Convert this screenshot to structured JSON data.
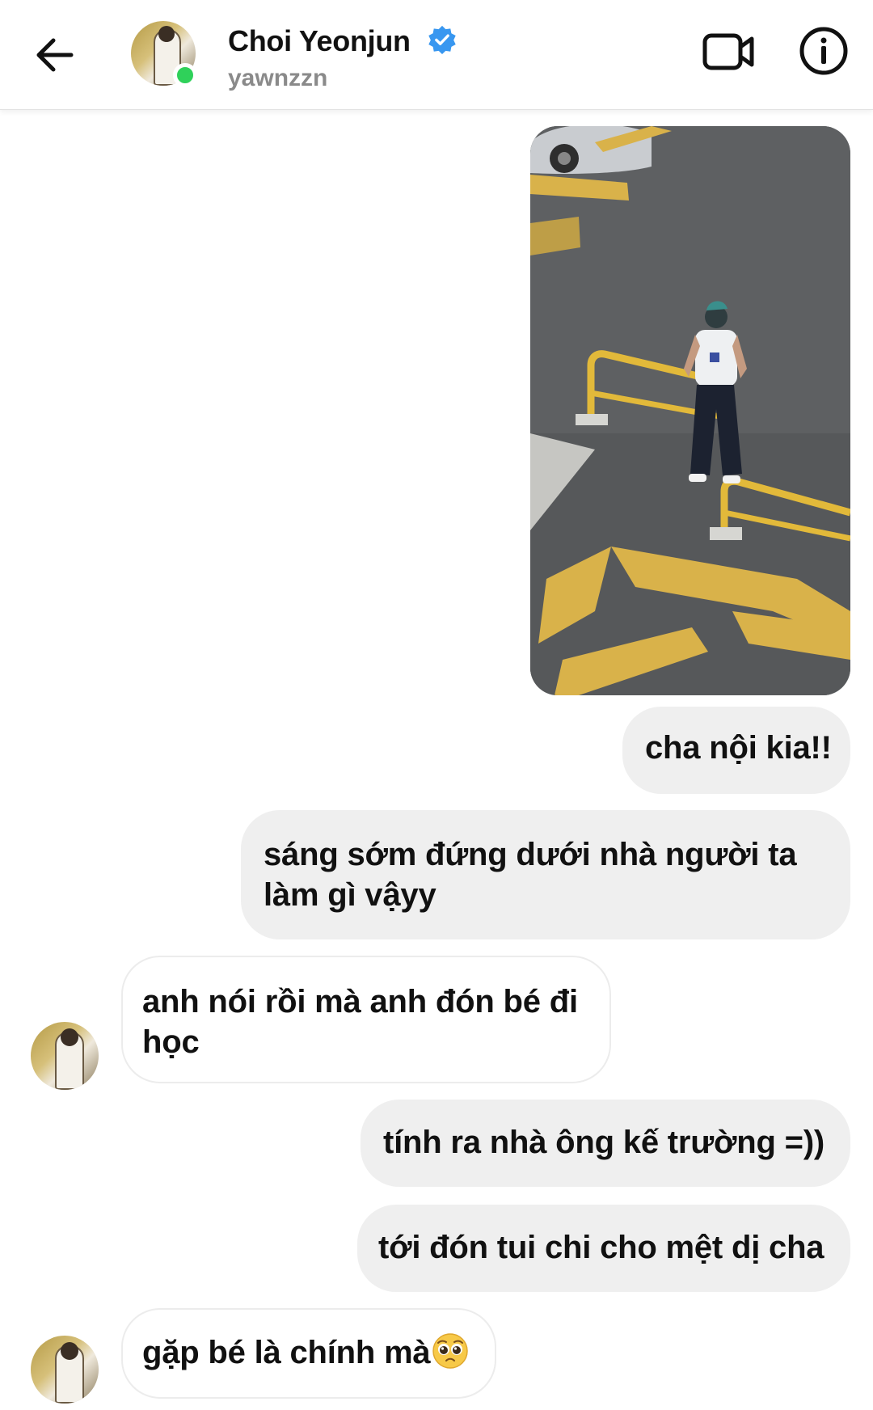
{
  "header": {
    "contact_name": "Choi Yeonjun",
    "username": "yawnzzn",
    "verified": true,
    "online": true,
    "icons": {
      "back": "back-arrow-icon",
      "verified": "verified-badge-icon",
      "video": "video-call-icon",
      "info": "info-icon"
    }
  },
  "colors": {
    "verified_blue": "#3897f0",
    "online_green": "#2fd15a",
    "outgoing_bubble": "#efefef",
    "incoming_bubble": "#ffffff"
  },
  "messages": [
    {
      "direction": "out",
      "type": "image"
    },
    {
      "direction": "out",
      "text": "cha nội kia!!"
    },
    {
      "direction": "out",
      "text": "sáng sớm đứng dưới nhà người ta\nlàm gì vậyy"
    },
    {
      "direction": "in",
      "text": "anh nói rồi mà anh đón bé đi\nhọc"
    },
    {
      "direction": "out",
      "text": "tính ra nhà ông kế trường =))"
    },
    {
      "direction": "out",
      "text": "tới đón tui chi cho mệt dị cha"
    },
    {
      "direction": "in",
      "text": "gặp bé là chính mà",
      "emoji": "pleading-face-emoji"
    }
  ]
}
